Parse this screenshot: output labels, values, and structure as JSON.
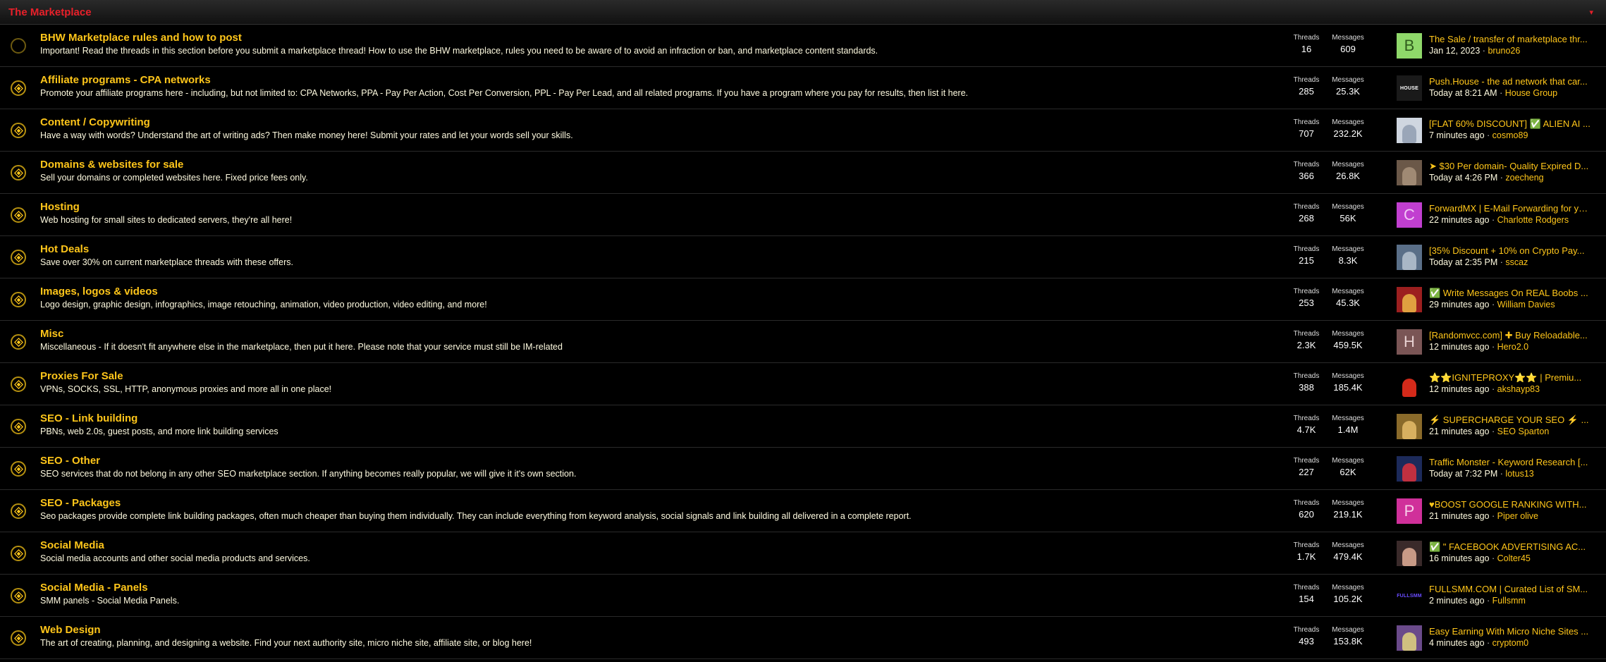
{
  "category": {
    "title": "The Marketplace",
    "collapse_glyph": "▾"
  },
  "stats_labels": {
    "threads": "Threads",
    "messages": "Messages"
  },
  "forums": [
    {
      "title": "BHW Marketplace rules and how to post",
      "description": "Important! Read the threads in this section before you submit a marketplace thread! How to use the BHW marketplace, rules you need to be aware of to avoid an infraction or ban, and marketplace content standards.",
      "threads": "16",
      "messages": "609",
      "unread": false,
      "avatar": {
        "letter": "B",
        "bg": "#8fd86a",
        "fg": "#2f5b1c",
        "kind": "letter"
      },
      "latest_title": "The Sale / transfer of marketplace thr...",
      "latest_time": "Jan 12, 2023",
      "latest_user": "bruno26"
    },
    {
      "title": "Affiliate programs - CPA networks",
      "description": "Promote your affiliate programs here - including, but not limited to: CPA Networks, PPA - Pay Per Action, Cost Per Conversion, PPL - Pay Per Lead, and all related programs. If you have a program where you pay for results, then list it here.",
      "threads": "285",
      "messages": "25.3K",
      "unread": true,
      "avatar": {
        "letter": "HOUSE",
        "bg": "#1a1a1a",
        "fg": "#fff",
        "kind": "logo"
      },
      "latest_title": "Push.House - the ad network that car...",
      "latest_time": "Today at 8:21 AM",
      "latest_user": "House Group"
    },
    {
      "title": "Content / Copywriting",
      "description": "Have a way with words? Understand the art of writing ads? Then make money here! Submit your rates and let your words sell your skills.",
      "threads": "707",
      "messages": "232.2K",
      "unread": true,
      "avatar": {
        "letter": "",
        "bg": "#cfd6e0",
        "fg": "#444",
        "kind": "photo",
        "tone": "#9aa6b8"
      },
      "latest_title": "[FLAT 60% DISCOUNT] ✅ ALIEN AI ...",
      "latest_time": "7 minutes ago",
      "latest_user": "cosmo89"
    },
    {
      "title": "Domains & websites for sale",
      "description": "Sell your domains or completed websites here. Fixed price fees only.",
      "threads": "366",
      "messages": "26.8K",
      "unread": true,
      "avatar": {
        "letter": "",
        "bg": "#6b5848",
        "fg": "#fff",
        "kind": "photo",
        "tone": "#a08a74"
      },
      "latest_title": "➤ $30 Per domain- Quality Expired D...",
      "latest_time": "Today at 4:26 PM",
      "latest_user": "zoecheng"
    },
    {
      "title": "Hosting",
      "description": "Web hosting for small sites to dedicated servers, they're all here!",
      "threads": "268",
      "messages": "56K",
      "unread": true,
      "avatar": {
        "letter": "C",
        "bg": "#c13fd0",
        "fg": "#f2c8f6",
        "kind": "letter"
      },
      "latest_title": "ForwardMX | E-Mail Forwarding for yo...",
      "latest_time": "22 minutes ago",
      "latest_user": "Charlotte Rodgers"
    },
    {
      "title": "Hot Deals",
      "description": "Save over 30% on current marketplace threads with these offers.",
      "threads": "215",
      "messages": "8.3K",
      "unread": true,
      "avatar": {
        "letter": "",
        "bg": "#5a6f88",
        "fg": "#fff",
        "kind": "photo",
        "tone": "#a9b7c6"
      },
      "latest_title": "[35% Discount + 10% on Crypto Pay...",
      "latest_time": "Today at 2:35 PM",
      "latest_user": "sscaz"
    },
    {
      "title": "Images, logos & videos",
      "description": "Logo design, graphic design, infographics, image retouching, animation, video production, video editing, and more!",
      "threads": "253",
      "messages": "45.3K",
      "unread": true,
      "avatar": {
        "letter": "",
        "bg": "#9c1f1f",
        "fg": "#fff",
        "kind": "photo",
        "tone": "#e0a040"
      },
      "latest_title": "✅ Write Messages On REAL Boobs ...",
      "latest_time": "29 minutes ago",
      "latest_user": "William Davies"
    },
    {
      "title": "Misc",
      "description": "Miscellaneous - If it doesn't fit anywhere else in the marketplace, then put it here. Please note that your service must still be IM-related",
      "threads": "2.3K",
      "messages": "459.5K",
      "unread": true,
      "avatar": {
        "letter": "H",
        "bg": "#7a5555",
        "fg": "#e8d2d2",
        "kind": "letter"
      },
      "latest_title": "[Randomvcc.com] ✚ Buy Reloadable...",
      "latest_time": "12 minutes ago",
      "latest_user": "Hero2.0"
    },
    {
      "title": "Proxies For Sale",
      "description": "VPNs, SOCKS, SSL, HTTP, anonymous proxies and more all in one place!",
      "threads": "388",
      "messages": "185.4K",
      "unread": true,
      "avatar": {
        "letter": "",
        "bg": "#000",
        "fg": "#fff",
        "kind": "photo",
        "tone": "#d42a1a"
      },
      "latest_title": "⭐⭐IGNITEPROXY⭐⭐ | Premiu...",
      "latest_time": "12 minutes ago",
      "latest_user": "akshayp83"
    },
    {
      "title": "SEO - Link building",
      "description": "PBNs, web 2.0s, guest posts, and more link building services",
      "threads": "4.7K",
      "messages": "1.4M",
      "unread": true,
      "avatar": {
        "letter": "",
        "bg": "#8a6a2a",
        "fg": "#fff",
        "kind": "photo",
        "tone": "#d8b060"
      },
      "latest_title": "⚡ SUPERCHARGE YOUR SEO ⚡ ...",
      "latest_time": "21 minutes ago",
      "latest_user": "SEO Sparton"
    },
    {
      "title": "SEO - Other",
      "description": "SEO services that do not belong in any other SEO marketplace section. If anything becomes really popular, we will give it it's own section.",
      "threads": "227",
      "messages": "62K",
      "unread": true,
      "avatar": {
        "letter": "",
        "bg": "#1c2a5a",
        "fg": "#fff",
        "kind": "photo",
        "tone": "#c03040"
      },
      "latest_title": "Traffic Monster - Keyword Research [...",
      "latest_time": "Today at 7:32 PM",
      "latest_user": "lotus13"
    },
    {
      "title": "SEO - Packages",
      "description": "Seo packages provide complete link building packages, often much cheaper than buying them individually. They can include everything from keyword analysis, social signals and link building all delivered in a complete report.",
      "threads": "620",
      "messages": "219.1K",
      "unread": true,
      "avatar": {
        "letter": "P",
        "bg": "#d0309a",
        "fg": "#f8d0ea",
        "kind": "letter"
      },
      "latest_title": "♥BOOST GOOGLE RANKING WITH...",
      "latest_time": "21 minutes ago",
      "latest_user": "Piper olive"
    },
    {
      "title": "Social Media",
      "description": "Social media accounts and other social media products and services.",
      "threads": "1.7K",
      "messages": "479.4K",
      "unread": true,
      "avatar": {
        "letter": "",
        "bg": "#3a2a2a",
        "fg": "#fff",
        "kind": "photo",
        "tone": "#c89a86"
      },
      "latest_title": "✅ \" FACEBOOK ADVERTISING AC...",
      "latest_time": "16 minutes ago",
      "latest_user": "Colter45"
    },
    {
      "title": "Social Media - Panels",
      "description": "SMM panels - Social Media Panels.",
      "threads": "154",
      "messages": "105.2K",
      "unread": true,
      "avatar": {
        "letter": "FULLSMM",
        "bg": "#000",
        "fg": "#6a4cff",
        "kind": "logo"
      },
      "latest_title": "FULLSMM.COM | Curated List of SM...",
      "latest_time": "2 minutes ago",
      "latest_user": "Fullsmm"
    },
    {
      "title": "Web Design",
      "description": "The art of creating, planning, and designing a website. Find your next authority site, micro niche site, affiliate site, or blog here!",
      "threads": "493",
      "messages": "153.8K",
      "unread": true,
      "avatar": {
        "letter": "",
        "bg": "#6a4a8a",
        "fg": "#fff",
        "kind": "photo",
        "tone": "#d0c080"
      },
      "latest_title": "Easy Earning With Micro Niche Sites ...",
      "latest_time": "4 minutes ago",
      "latest_user": "cryptom0"
    }
  ],
  "separator": "·"
}
